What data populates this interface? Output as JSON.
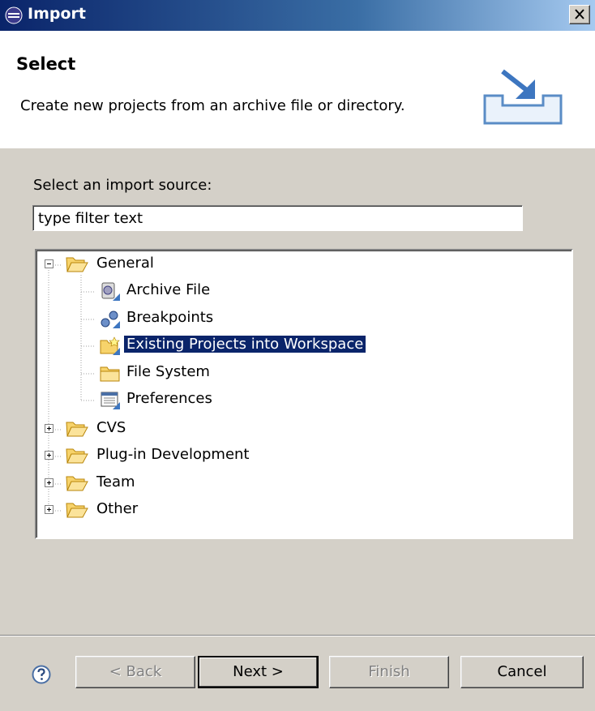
{
  "window": {
    "title": "Import"
  },
  "header": {
    "heading": "Select",
    "description": "Create new projects from an archive file or directory."
  },
  "body": {
    "source_label": "Select an import source:",
    "filter_value": "type filter text"
  },
  "tree": {
    "nodes": [
      {
        "label": "General",
        "icon": "folder-open-icon",
        "expanded": true
      },
      {
        "label": "Archive File",
        "icon": "archive-icon"
      },
      {
        "label": "Breakpoints",
        "icon": "breakpoints-icon"
      },
      {
        "label": "Existing Projects into Workspace",
        "icon": "project-icon",
        "selected": true
      },
      {
        "label": "File System",
        "icon": "folder-icon"
      },
      {
        "label": "Preferences",
        "icon": "preferences-icon"
      },
      {
        "label": "CVS",
        "icon": "folder-open-icon",
        "expanded": false
      },
      {
        "label": "Plug-in Development",
        "icon": "folder-open-icon",
        "expanded": false
      },
      {
        "label": "Team",
        "icon": "folder-open-icon",
        "expanded": false
      },
      {
        "label": "Other",
        "icon": "folder-open-icon",
        "expanded": false
      }
    ]
  },
  "buttons": {
    "back": "< Back",
    "next": "Next >",
    "finish": "Finish",
    "cancel": "Cancel"
  },
  "colors": {
    "selection": "#0a246a",
    "dialog_bg": "#d4d0c8"
  }
}
